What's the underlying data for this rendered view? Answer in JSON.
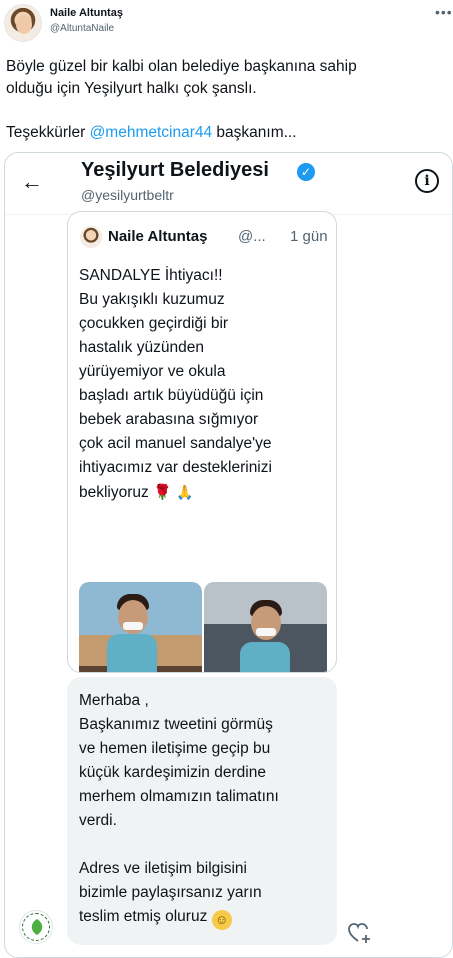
{
  "tweet": {
    "author_name": "Naile Altuntaş",
    "author_handle": "@AltuntaNaile",
    "text_line1": "Böyle güzel bir kalbi olan belediye başkanına sahip",
    "text_line2": "olduğu için Yeşilyurt halkı çok şanslı.",
    "text_thanks": "Teşekkürler",
    "mention": "@mehmetcinar44",
    "text_end": " başkanım..."
  },
  "embedded": {
    "title": "Yeşilyurt Belediyesi",
    "handle": "@yesilyurtbeltr",
    "shared_tweet": {
      "name": "Naile Altuntaş",
      "handle": "@...",
      "time": "1 gün",
      "lines": [
        "SANDALYE İhtiyacı!!",
        "Bu yakışıklı kuzumuz",
        "çocukken geçirdiği bir",
        "hastalık yüzünden",
        "yürüyemiyor ve okula",
        "başladı artık büyüdüğü için",
        "bebek arabasına sığmıyor",
        "çok acil manuel sandalye'ye",
        "ihtiyacımız var desteklerinizi"
      ],
      "last_line": "bekliyoruz"
    },
    "reply": {
      "lines_a": [
        "Merhaba ,",
        "Başkanımız tweetini görmüş",
        "ve hemen iletişime geçip bu",
        "küçük kardeşimizin derdine",
        "merhem olmamızın talimatını",
        "verdi."
      ],
      "lines_b": [
        "Adres ve iletişim bilgisini",
        "bizimle paylaşırsanız yarın"
      ],
      "last_line": "teslim etmiş oluruz"
    }
  },
  "icons": {
    "more": "more-dots-icon",
    "back": "back-arrow-icon",
    "verified": "verified-badge-icon",
    "info": "info-icon",
    "reaction": "add-reaction-icon"
  },
  "colors": {
    "link": "#1d9bf0",
    "secondary_text": "#536471",
    "bubble": "#eff3f4"
  }
}
